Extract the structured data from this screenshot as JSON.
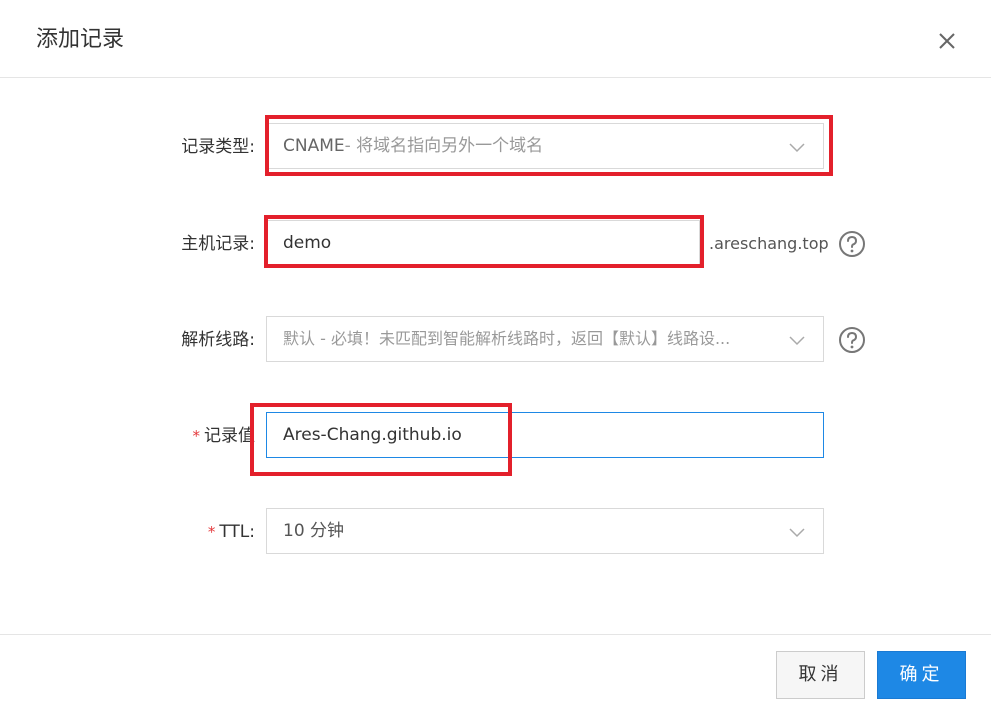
{
  "dialog": {
    "title": "添加记录",
    "close_icon": "close-icon"
  },
  "form": {
    "record_type": {
      "label": "记录类型:",
      "prefix": "CNAME",
      "value": "- 将域名指向另外一个域名",
      "icon": "chevron-down-icon"
    },
    "host_record": {
      "label": "主机记录:",
      "value": "demo",
      "suffix": ".areschang.top",
      "help_icon": "question-circle-icon"
    },
    "line": {
      "label": "解析线路:",
      "value": "默认 - 必填！未匹配到智能解析线路时，返回【默认】线路设...",
      "icon": "chevron-down-icon",
      "help_icon": "question-circle-icon"
    },
    "record_value": {
      "required": "*",
      "label": "记录值",
      "value": "Ares-Chang.github.io"
    },
    "ttl": {
      "required": "*",
      "label": "TTL:",
      "value": "10 分钟",
      "icon": "chevron-down-icon"
    }
  },
  "footer": {
    "cancel_label": "取消",
    "ok_label": "确定"
  },
  "colors": {
    "primary": "#1e88e5",
    "highlight": "#e3202b",
    "required": "#e4393c",
    "border": "#d9d9d9"
  }
}
